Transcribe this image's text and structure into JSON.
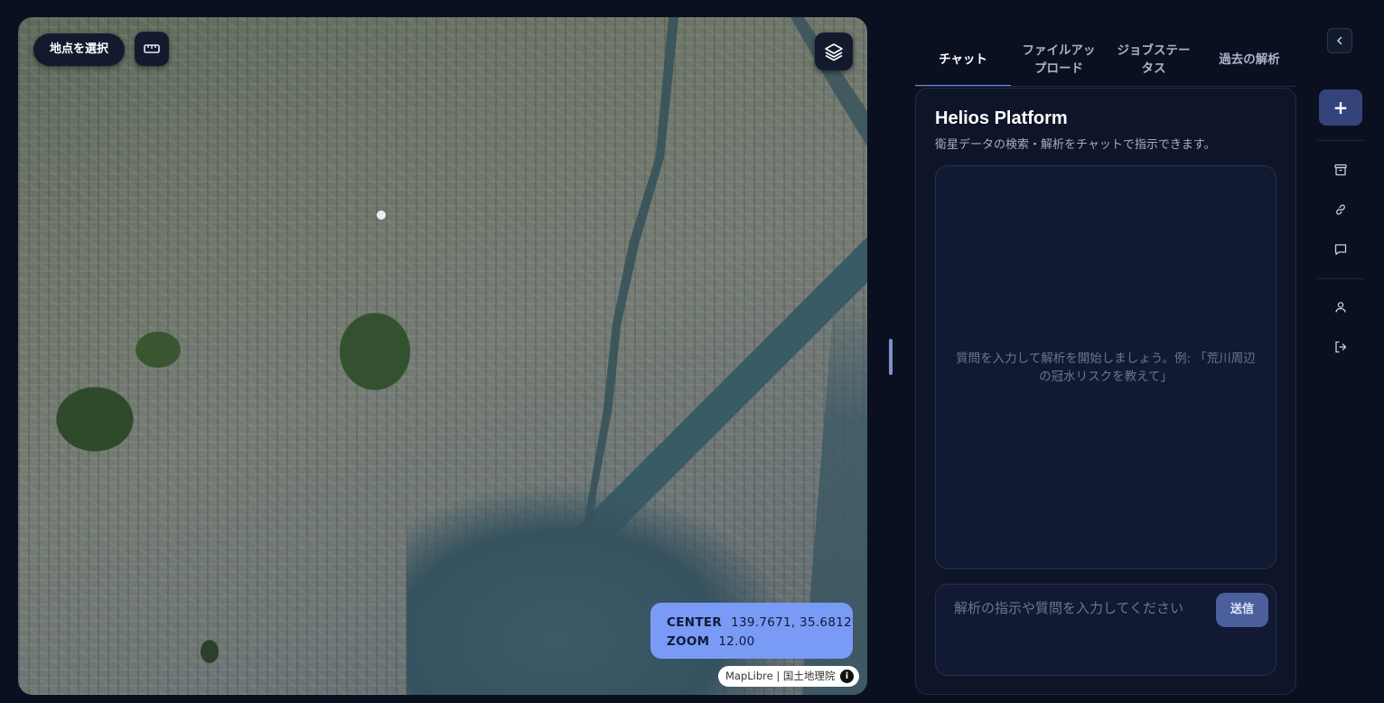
{
  "map": {
    "select_point_label": "地点を選択",
    "coords": {
      "center_label": "CENTER",
      "center_value": "139.7671, 35.6812",
      "zoom_label": "ZOOM",
      "zoom_value": "12.00"
    },
    "attribution": "MapLibre | 国土地理院",
    "info_glyph": "i"
  },
  "tabs": [
    {
      "label": "チャット",
      "active": true
    },
    {
      "label": "ファイルアップロード",
      "active": false
    },
    {
      "label": "ジョブステータス",
      "active": false
    },
    {
      "label": "過去の解析",
      "active": false
    }
  ],
  "chat": {
    "title": "Helios Platform",
    "subtitle": "衛星データの検索・解析をチャットで指示できます。",
    "empty_message": "質問を入力して解析を開始しましょう。例: 「荒川周辺の冠水リスクを教えて」",
    "input_placeholder": "解析の指示や質問を入力してください",
    "send_label": "送信"
  },
  "rail": {
    "new_label": "+",
    "icons": [
      "archive-icon",
      "link-icon",
      "message-icon",
      "user-icon",
      "logout-icon"
    ]
  },
  "colors": {
    "accent": "#6f8ff0",
    "coords_bg": "#7a9bf5",
    "panel_bg": "#0f1528",
    "page_bg": "#0b1020"
  }
}
